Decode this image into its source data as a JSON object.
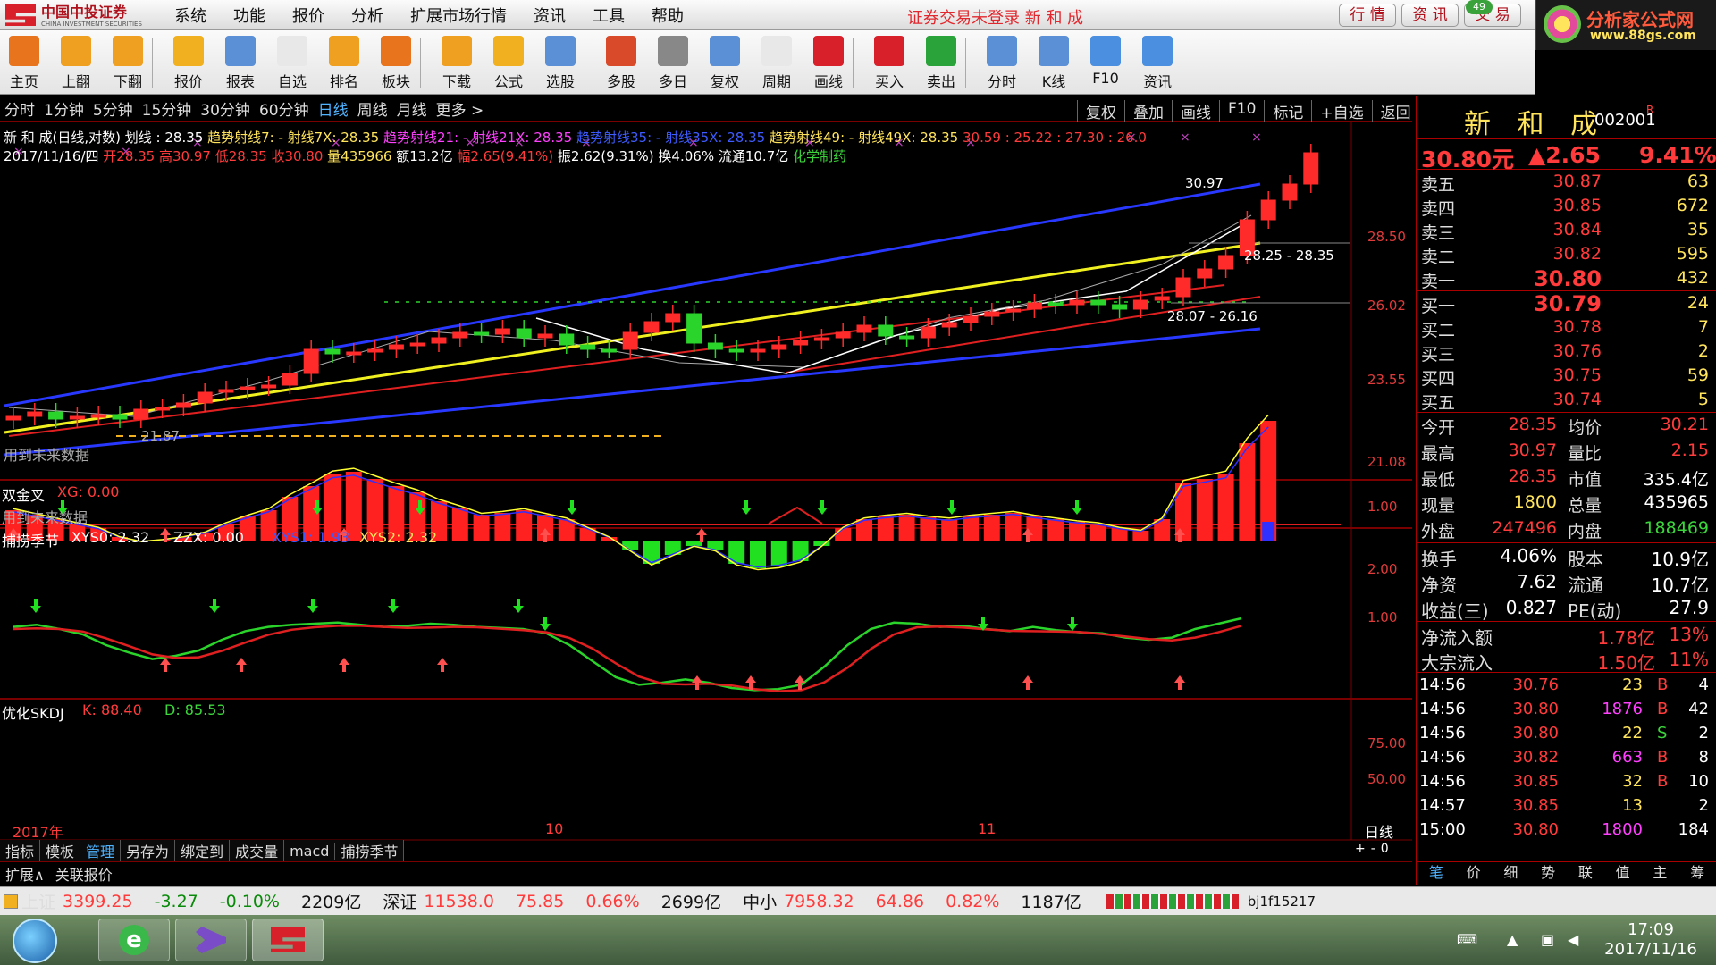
{
  "app": {
    "brand_cn": "中国中投证券",
    "brand_en": "CHINA INVESTMENT SECURITIES",
    "status_msg": "证券交易未登录  新 和 成",
    "right_tabs": [
      "行 情",
      "资 讯",
      "交 易"
    ],
    "msg_count": "49",
    "ad_title": "分析家公式网",
    "ad_url": "www.88gs.com"
  },
  "menu": [
    "系统",
    "功能",
    "报价",
    "分析",
    "扩展市场行情",
    "资讯",
    "工具",
    "帮助"
  ],
  "toolbar": [
    {
      "label": "主页",
      "icon": "home-icon",
      "color": "#e8741e"
    },
    {
      "label": "上翻",
      "icon": "arrow-up-icon",
      "color": "#f0a020"
    },
    {
      "label": "下翻",
      "icon": "arrow-down-icon",
      "color": "#f0a020"
    },
    {
      "label": "报价",
      "icon": "yen-icon",
      "color": "#f0b020"
    },
    {
      "label": "报表",
      "icon": "report-icon",
      "color": "#5b8fd6"
    },
    {
      "label": "自选",
      "icon": "f6-icon",
      "color": "#e8e8e8"
    },
    {
      "label": "排名",
      "icon": "rank-icon",
      "color": "#f0a020"
    },
    {
      "label": "板块",
      "icon": "blocks-icon",
      "color": "#e8741e"
    },
    {
      "label": "下载",
      "icon": "download-icon",
      "color": "#f0a020"
    },
    {
      "label": "公式",
      "icon": "formula-icon",
      "color": "#f0b020"
    },
    {
      "label": "选股",
      "icon": "pick-icon",
      "color": "#5b8fd6"
    },
    {
      "label": "多股",
      "icon": "multi-icon",
      "color": "#d84a2a"
    },
    {
      "label": "多日",
      "icon": "clock-icon",
      "color": "#888888"
    },
    {
      "label": "复权",
      "icon": "restore-icon",
      "color": "#5b8fd6"
    },
    {
      "label": "周期",
      "icon": "f8-icon",
      "color": "#e8e8e8"
    },
    {
      "label": "画线",
      "icon": "pencil-icon",
      "color": "#d8202a"
    },
    {
      "label": "买入",
      "icon": "buy-icon",
      "color": "#d8202a"
    },
    {
      "label": "卖出",
      "icon": "sell-icon",
      "color": "#2aa33a"
    },
    {
      "label": "分时",
      "icon": "timeshare-icon",
      "color": "#5b8fd6"
    },
    {
      "label": "K线",
      "icon": "kline-icon",
      "color": "#5b8fd6"
    },
    {
      "label": "F10",
      "icon": "f10-icon",
      "color": "#4a8fe0"
    },
    {
      "label": "资讯",
      "icon": "news-icon",
      "color": "#4a8fe0"
    }
  ],
  "timeframes": [
    "分时",
    "1分钟",
    "5分钟",
    "15分钟",
    "30分钟",
    "60分钟",
    "日线",
    "周线",
    "月线",
    "更多 >"
  ],
  "active_timeframe": "日线",
  "chart_buttons": [
    "复权",
    "叠加",
    "画线",
    "F10",
    "标记",
    "+自选",
    "返回"
  ],
  "chart": {
    "info_line1": [
      {
        "t": "新 和 成(日线,对数) 划线 : 28.35  ",
        "c": "wht"
      },
      {
        "t": "趋势射线7: - 射线7X: 28.35  ",
        "c": "yel"
      },
      {
        "t": "趋势射线21: - 射线21X: 28.35  ",
        "c": "mag"
      },
      {
        "t": "趋势射线35: - 射线35X: 28.35  ",
        "c": "blu"
      },
      {
        "t": "趋势射线49: - 射线49X: 28.35  ",
        "c": "yel"
      },
      {
        "t": "30.59 : 25.22 : 27.30 : 26.0",
        "c": "red"
      }
    ],
    "info_line2": [
      {
        "t": "2017/11/16/四 ",
        "c": "wht"
      },
      {
        "t": "开28.35 ",
        "c": "red"
      },
      {
        "t": "高30.97 ",
        "c": "red"
      },
      {
        "t": "低28.35 ",
        "c": "red"
      },
      {
        "t": "收30.80 ",
        "c": "red"
      },
      {
        "t": "量435966 ",
        "c": "yel"
      },
      {
        "t": "额13.2亿 ",
        "c": "wht"
      },
      {
        "t": "幅2.65(9.41%) ",
        "c": "red"
      },
      {
        "t": "振2.62(9.31%) ",
        "c": "wht"
      },
      {
        "t": "换4.06% ",
        "c": "wht"
      },
      {
        "t": "流通10.7亿 ",
        "c": "wht"
      },
      {
        "t": "化学制药",
        "c": "grn"
      }
    ],
    "price_axis": [
      "28.50",
      "26.02",
      "23.55",
      "21.08"
    ],
    "annotations": {
      "high": "30.97",
      "low": "21.87",
      "range1": "28.25 - 28.35",
      "range2": "28.07 - 26.16",
      "future1": "用到未来数据",
      "future2": "用到未来数据"
    },
    "sub1": {
      "title": "双金叉",
      "xg": "XG: 0.00",
      "axis": "1.00"
    },
    "sub2": {
      "title": "捕捞季节",
      "xys0": "XYS0: 2.32",
      "zzx": "ZZX: 0.00",
      "xys1": "XYS1: 1.93",
      "xys2": "XYS2: 2.32",
      "axis": [
        "2.00",
        "1.00"
      ]
    },
    "sub3": {
      "title": "优化SKDJ",
      "k": "K: 88.40",
      "d": "D: 85.53",
      "axis": [
        "75.00",
        "50.00"
      ]
    },
    "dates": [
      "2017年",
      "10",
      "11"
    ],
    "period_label": "日线",
    "zoom": [
      "+",
      "-",
      "0"
    ]
  },
  "bottom_tabs": [
    "指标",
    "模板",
    "管理",
    "另存为",
    "绑定到",
    "成交量",
    "macd",
    "捕捞季节"
  ],
  "active_bottom_tab": "管理",
  "ext_tabs": [
    "扩展∧",
    "关联报价"
  ],
  "quote": {
    "name": "新 和 成",
    "code": "002001",
    "mark": "R",
    "price": "30.80元",
    "change": "▲2.65",
    "pct": "9.41%",
    "asks": [
      {
        "l": "卖五",
        "p": "30.87",
        "v": "63"
      },
      {
        "l": "卖四",
        "p": "30.85",
        "v": "672"
      },
      {
        "l": "卖三",
        "p": "30.84",
        "v": "35"
      },
      {
        "l": "卖二",
        "p": "30.82",
        "v": "595"
      },
      {
        "l": "卖一",
        "p": "30.80",
        "v": "432"
      }
    ],
    "bids": [
      {
        "l": "买一",
        "p": "30.79",
        "v": "24"
      },
      {
        "l": "买二",
        "p": "30.78",
        "v": "7"
      },
      {
        "l": "买三",
        "p": "30.76",
        "v": "2"
      },
      {
        "l": "买四",
        "p": "30.75",
        "v": "59"
      },
      {
        "l": "买五",
        "p": "30.74",
        "v": "5"
      }
    ],
    "stats": [
      {
        "l1": "今开",
        "v1": "28.35",
        "c1": "red",
        "l2": "均价",
        "v2": "30.21",
        "c2": "red"
      },
      {
        "l1": "最高",
        "v1": "30.97",
        "c1": "red",
        "l2": "量比",
        "v2": "2.15",
        "c2": "red"
      },
      {
        "l1": "最低",
        "v1": "28.35",
        "c1": "red",
        "l2": "市值",
        "v2": "335.4亿",
        "c2": "wht"
      },
      {
        "l1": "现量",
        "v1": "1800",
        "c1": "yel",
        "l2": "总量",
        "v2": "435965",
        "c2": "wht"
      },
      {
        "l1": "外盘",
        "v1": "247496",
        "c1": "red",
        "l2": "内盘",
        "v2": "188469",
        "c2": "grn"
      }
    ],
    "fin": [
      {
        "l1": "换手",
        "v1": "4.06%",
        "l2": "股本",
        "v2": "10.9亿"
      },
      {
        "l1": "净资",
        "v1": "7.62",
        "l2": "流通",
        "v2": "10.7亿"
      },
      {
        "l1": "收益(三)",
        "v1": "0.827",
        "l2": "PE(动)",
        "v2": "27.9"
      }
    ],
    "flows": [
      {
        "l": "净流入额",
        "v": "1.78亿",
        "p": "13%"
      },
      {
        "l": "大宗流入",
        "v": "1.50亿",
        "p": "11%"
      }
    ],
    "ticks": [
      {
        "t": "14:56",
        "p": "30.76",
        "v": "23",
        "vc": "yel",
        "s": "B",
        "n": "4"
      },
      {
        "t": "14:56",
        "p": "30.80",
        "v": "1876",
        "vc": "mag",
        "s": "B",
        "n": "42"
      },
      {
        "t": "14:56",
        "p": "30.80",
        "v": "22",
        "vc": "yel",
        "s": "S",
        "n": "2"
      },
      {
        "t": "14:56",
        "p": "30.82",
        "v": "663",
        "vc": "mag",
        "s": "B",
        "n": "8"
      },
      {
        "t": "14:56",
        "p": "30.85",
        "v": "32",
        "vc": "yel",
        "s": "B",
        "n": "10"
      },
      {
        "t": "14:57",
        "p": "30.85",
        "v": "13",
        "vc": "yel",
        "s": "",
        "n": "2"
      },
      {
        "t": "15:00",
        "p": "30.80",
        "v": "1800",
        "vc": "mag",
        "s": "",
        "n": "184"
      }
    ],
    "side_tabs": [
      "笔",
      "价",
      "细",
      "势",
      "联",
      "值",
      "主",
      "筹"
    ]
  },
  "statusbar": {
    "sh_name": "上证",
    "sh_val": "3399.25",
    "sh_chg": "-3.27",
    "sh_pct": "-0.10%",
    "sh_amt": "2209亿",
    "sz_name": "深证",
    "sz_val": "11538.0",
    "sz_chg": "75.85",
    "sz_pct": "0.66%",
    "sz_amt": "2699亿",
    "zx_name": "中小",
    "zx_val": "7958.32",
    "zx_chg": "64.86",
    "zx_pct": "0.82%",
    "zx_amt": "1187亿",
    "user": "bj1f15217"
  },
  "taskbar": {
    "time": "17:09",
    "date": "2017/11/16"
  }
}
